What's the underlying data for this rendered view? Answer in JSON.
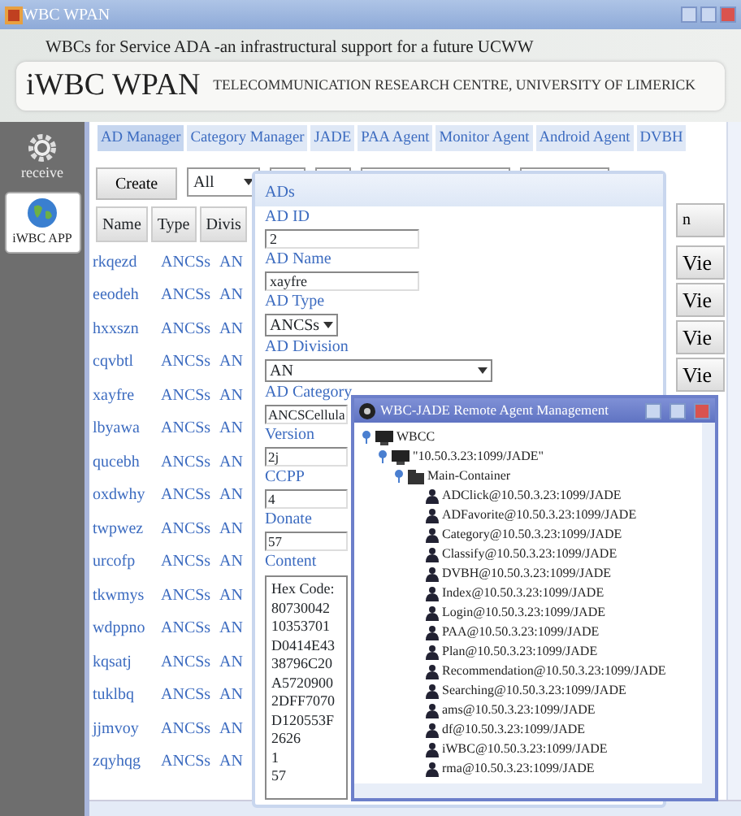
{
  "window": {
    "title": "WBC WPAN"
  },
  "header": {
    "subtitle": "WBCs for Service ADA -an infrastructural support for a future UCWW",
    "app_name": "iWBC WPAN",
    "organization": "TELECOMMUNICATION RESEARCH CENTRE, UNIVERSITY OF LIMERICK"
  },
  "sidebar": {
    "items": [
      {
        "label": "receive",
        "kind": "gear",
        "selected": false
      },
      {
        "label": "iWBC APP",
        "kind": "globe",
        "selected": true
      }
    ]
  },
  "tabs": [
    {
      "label": "AD Manager",
      "selected": true
    },
    {
      "label": "Category Manager",
      "selected": false
    },
    {
      "label": "JADE",
      "selected": false
    },
    {
      "label": "PAA Agent",
      "selected": false
    },
    {
      "label": "Monitor Agent",
      "selected": false
    },
    {
      "label": "Android Agent",
      "selected": false
    },
    {
      "label": "DVBH",
      "selected": false
    }
  ],
  "toolbar": {
    "create_button": "Create",
    "filter": {
      "value": "All"
    }
  },
  "table": {
    "columns": [
      "Name",
      "Type",
      "Divis"
    ],
    "rows": [
      [
        "rkqezd",
        "ANCSs",
        "AN"
      ],
      [
        "eeodeh",
        "ANCSs",
        "AN"
      ],
      [
        "hxxszn",
        "ANCSs",
        "AN"
      ],
      [
        "cqvbtl",
        "ANCSs",
        "AN"
      ],
      [
        "xayfre",
        "ANCSs",
        "AN"
      ],
      [
        "lbyawa",
        "ANCSs",
        "AN"
      ],
      [
        "qucebh",
        "ANCSs",
        "AN"
      ],
      [
        "oxdwhy",
        "ANCSs",
        "AN"
      ],
      [
        "twpwez",
        "ANCSs",
        "AN"
      ],
      [
        "urcofp",
        "ANCSs",
        "AN"
      ],
      [
        "tkwmys",
        "ANCSs",
        "AN"
      ],
      [
        "wdppno",
        "ANCSs",
        "AN"
      ],
      [
        "kqsatj",
        "ANCSs",
        "AN"
      ],
      [
        "tuklbq",
        "ANCSs",
        "AN"
      ],
      [
        "jjmvoy",
        "ANCSs",
        "AN"
      ],
      [
        "zqyhqg",
        "ANCSs",
        "AN"
      ]
    ]
  },
  "action_column": {
    "header": "n",
    "buttons": [
      "Vie",
      "Vie",
      "Vie",
      "Vie"
    ]
  },
  "ads_dialog": {
    "title": "ADs",
    "fields": [
      {
        "label": "AD ID",
        "kind": "text",
        "value": "2"
      },
      {
        "label": "AD Name",
        "kind": "text",
        "value": "xayfre"
      },
      {
        "label": "AD Type",
        "kind": "select",
        "value": "ANCSs"
      },
      {
        "label": "AD Division",
        "kind": "select",
        "value": "AN"
      },
      {
        "label": "AD Category",
        "kind": "text",
        "value": "ANCSCellula"
      },
      {
        "label": "Version",
        "kind": "text",
        "value": "2j"
      },
      {
        "label": "CCPP",
        "kind": "text",
        "value": "4"
      },
      {
        "label": "Donate",
        "kind": "text",
        "value": "57"
      },
      {
        "label": "Content",
        "kind": "textarea",
        "lines": [
          "Hex Code:",
          "80730042",
          "10353701",
          "D0414E43",
          "38796C20",
          "A5720900",
          "2DFF7070",
          "D120553F",
          "2626",
          "1",
          "57"
        ]
      }
    ]
  },
  "jade_window": {
    "title": "WBC-JADE Remote Agent Management",
    "tree": [
      {
        "label": "WBCC",
        "kind": "platform",
        "expanded": true,
        "children": [
          {
            "label": "\"10.50.3.23:1099/JADE\"",
            "kind": "platform",
            "expanded": true,
            "children": [
              {
                "label": "Main-Container",
                "kind": "container",
                "expanded": true,
                "children": [
                  {
                    "label": "ADClick@10.50.3.23:1099/JADE",
                    "kind": "agent"
                  },
                  {
                    "label": "ADFavorite@10.50.3.23:1099/JADE",
                    "kind": "agent"
                  },
                  {
                    "label": "Category@10.50.3.23:1099/JADE",
                    "kind": "agent"
                  },
                  {
                    "label": "Classify@10.50.3.23:1099/JADE",
                    "kind": "agent"
                  },
                  {
                    "label": "DVBH@10.50.3.23:1099/JADE",
                    "kind": "agent"
                  },
                  {
                    "label": "Index@10.50.3.23:1099/JADE",
                    "kind": "agent"
                  },
                  {
                    "label": "Login@10.50.3.23:1099/JADE",
                    "kind": "agent"
                  },
                  {
                    "label": "PAA@10.50.3.23:1099/JADE",
                    "kind": "agent"
                  },
                  {
                    "label": "Plan@10.50.3.23:1099/JADE",
                    "kind": "agent"
                  },
                  {
                    "label": "Recommendation@10.50.3.23:1099/JADE",
                    "kind": "agent"
                  },
                  {
                    "label": "Searching@10.50.3.23:1099/JADE",
                    "kind": "agent"
                  },
                  {
                    "label": "ams@10.50.3.23:1099/JADE",
                    "kind": "agent"
                  },
                  {
                    "label": "df@10.50.3.23:1099/JADE",
                    "kind": "agent"
                  },
                  {
                    "label": "iWBC@10.50.3.23:1099/JADE",
                    "kind": "agent"
                  },
                  {
                    "label": "rma@10.50.3.23:1099/JADE",
                    "kind": "agent"
                  }
                ]
              }
            ]
          }
        ]
      }
    ]
  }
}
